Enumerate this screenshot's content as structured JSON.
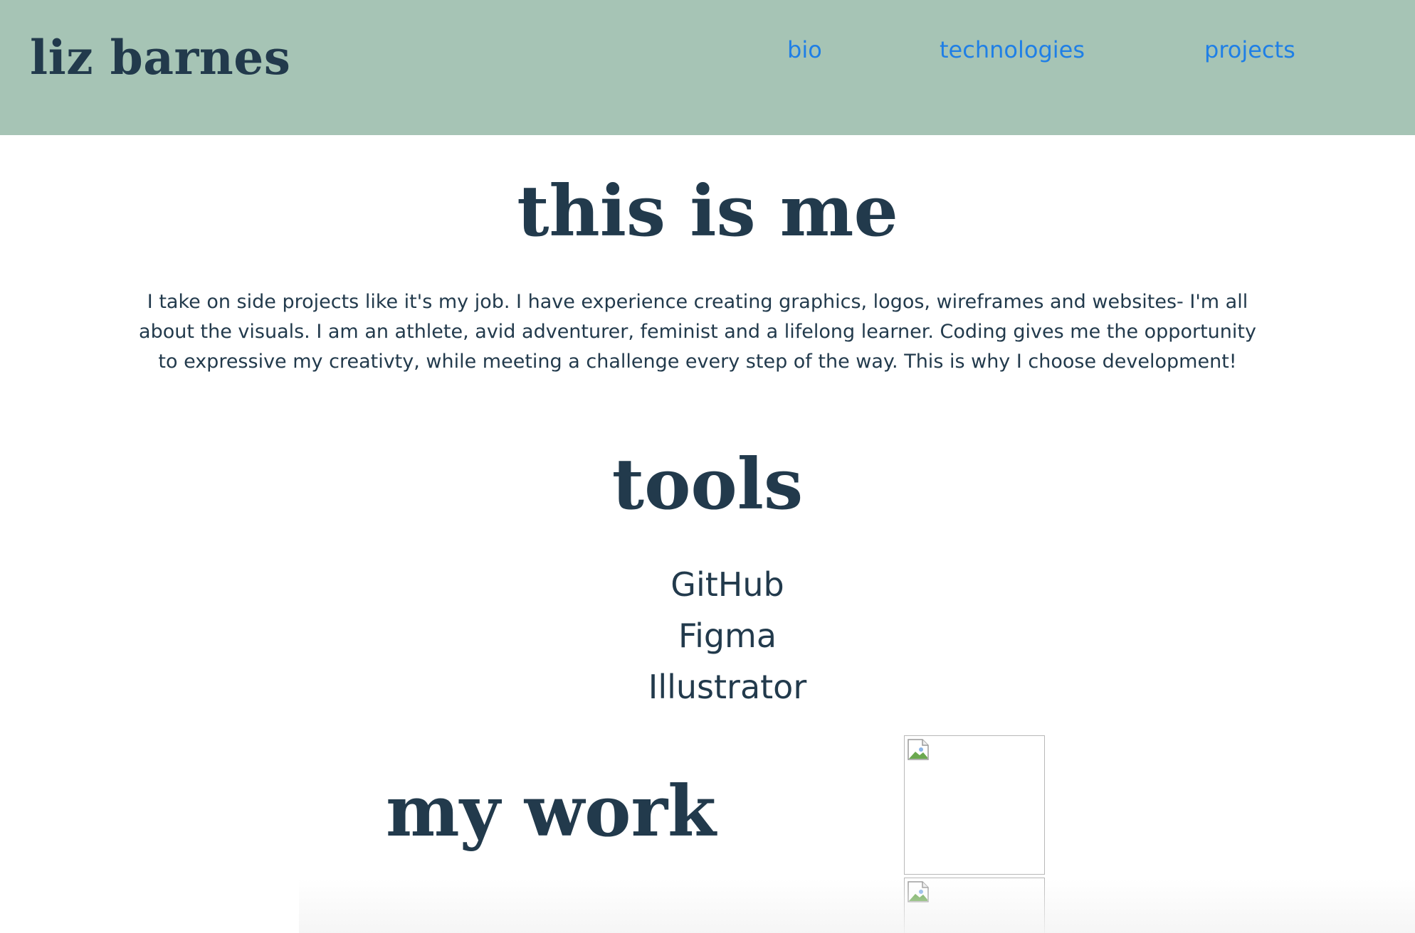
{
  "header": {
    "logo": "liz barnes",
    "nav": [
      {
        "label": "bio"
      },
      {
        "label": "technologies"
      },
      {
        "label": "projects"
      }
    ],
    "background_color": "#a6c4b5",
    "link_color": "#1f7fe6"
  },
  "bio_section": {
    "title": "this is me",
    "text": "I take on side projects like it's my job. I have experience creating graphics, logos, wireframes and websites- I'm all about the visuals. I am an athlete, avid adventurer, feminist and a lifelong learner. Coding gives me the opportunity to expressive my creativty, while meeting a challenge every step of the way. This is why I choose development!"
  },
  "tools_section": {
    "title": "tools",
    "items": [
      "GitHub",
      "Figma",
      "Illustrator"
    ]
  },
  "work_section": {
    "title": "my work",
    "images": [
      {
        "icon": "broken-image-icon"
      },
      {
        "icon": "broken-image-icon"
      }
    ]
  },
  "text_color": "#223a4c"
}
